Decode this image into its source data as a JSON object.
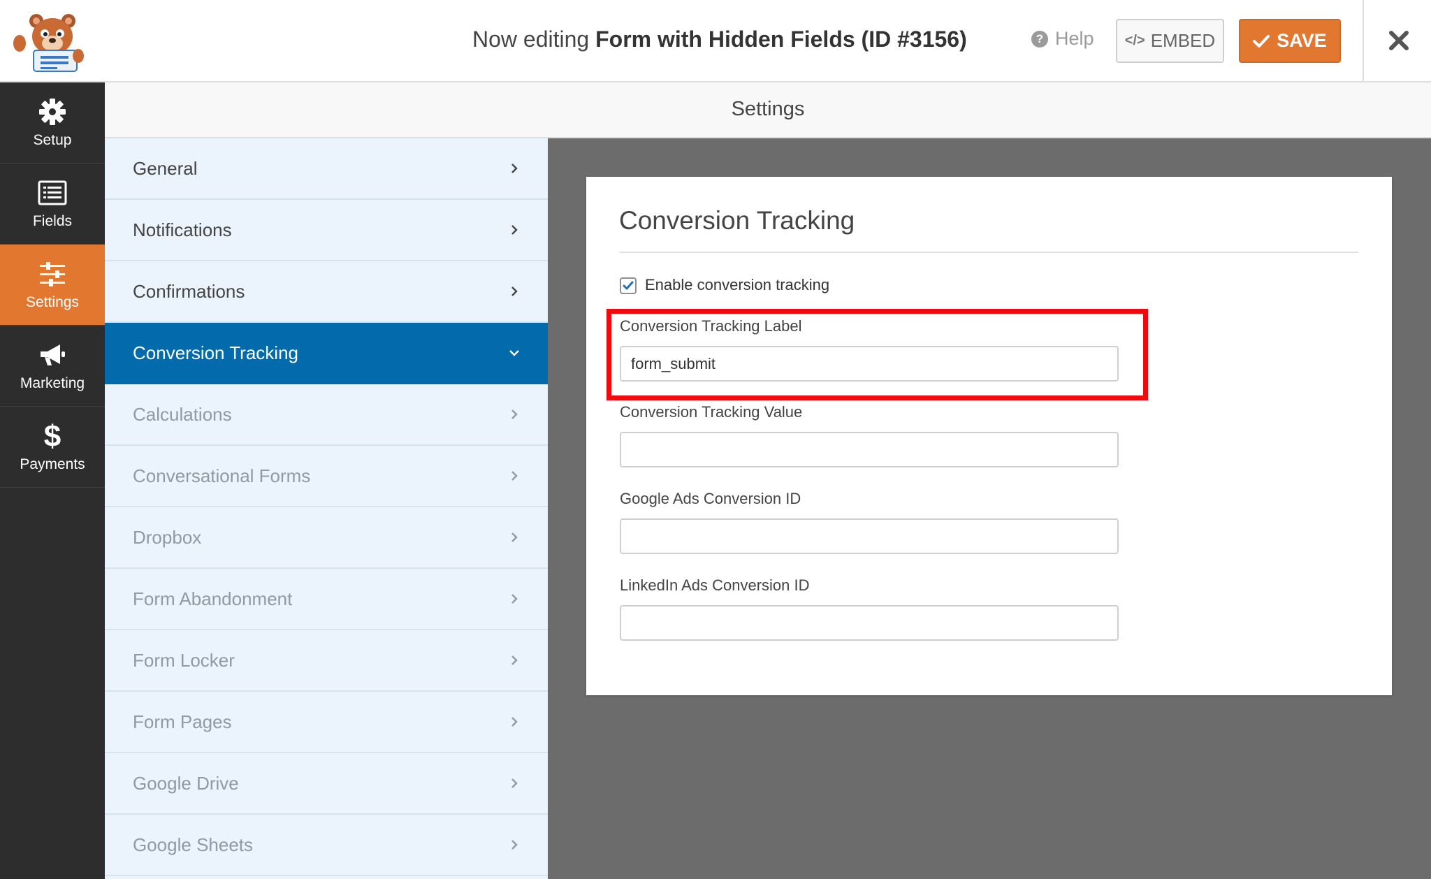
{
  "header": {
    "editing_prefix": "Now editing ",
    "form_name": "Form with Hidden Fields (ID #3156)",
    "help_label": "Help",
    "embed_label": "EMBED",
    "save_label": "SAVE"
  },
  "leftnav": {
    "items": [
      {
        "label": "Setup",
        "icon": "gear-icon"
      },
      {
        "label": "Fields",
        "icon": "fields-list-icon"
      },
      {
        "label": "Settings",
        "icon": "sliders-icon",
        "active": true
      },
      {
        "label": "Marketing",
        "icon": "megaphone-icon"
      },
      {
        "label": "Payments",
        "icon": "dollar-icon"
      }
    ]
  },
  "settings_header": "Settings",
  "panels": {
    "items": [
      {
        "label": "General",
        "state": "normal"
      },
      {
        "label": "Notifications",
        "state": "normal"
      },
      {
        "label": "Confirmations",
        "state": "normal"
      },
      {
        "label": "Conversion Tracking",
        "state": "active"
      },
      {
        "label": "Calculations",
        "state": "muted"
      },
      {
        "label": "Conversational Forms",
        "state": "muted"
      },
      {
        "label": "Dropbox",
        "state": "muted"
      },
      {
        "label": "Form Abandonment",
        "state": "muted"
      },
      {
        "label": "Form Locker",
        "state": "muted"
      },
      {
        "label": "Form Pages",
        "state": "muted"
      },
      {
        "label": "Google Drive",
        "state": "muted"
      },
      {
        "label": "Google Sheets",
        "state": "muted"
      }
    ]
  },
  "conversion": {
    "title": "Conversion Tracking",
    "enable_label": "Enable conversion tracking",
    "enable_checked": true,
    "label_field": {
      "label": "Conversion Tracking Label",
      "value": "form_submit"
    },
    "value_field": {
      "label": "Conversion Tracking Value",
      "value": ""
    },
    "google_field": {
      "label": "Google Ads Conversion ID",
      "value": ""
    },
    "linkedin_field": {
      "label": "LinkedIn Ads Conversion ID",
      "value": ""
    }
  },
  "colors": {
    "accent_orange": "#e27730",
    "active_blue": "#036aab",
    "highlight_red": "#ee0a0f",
    "nav_dark": "#2d2d2d"
  }
}
